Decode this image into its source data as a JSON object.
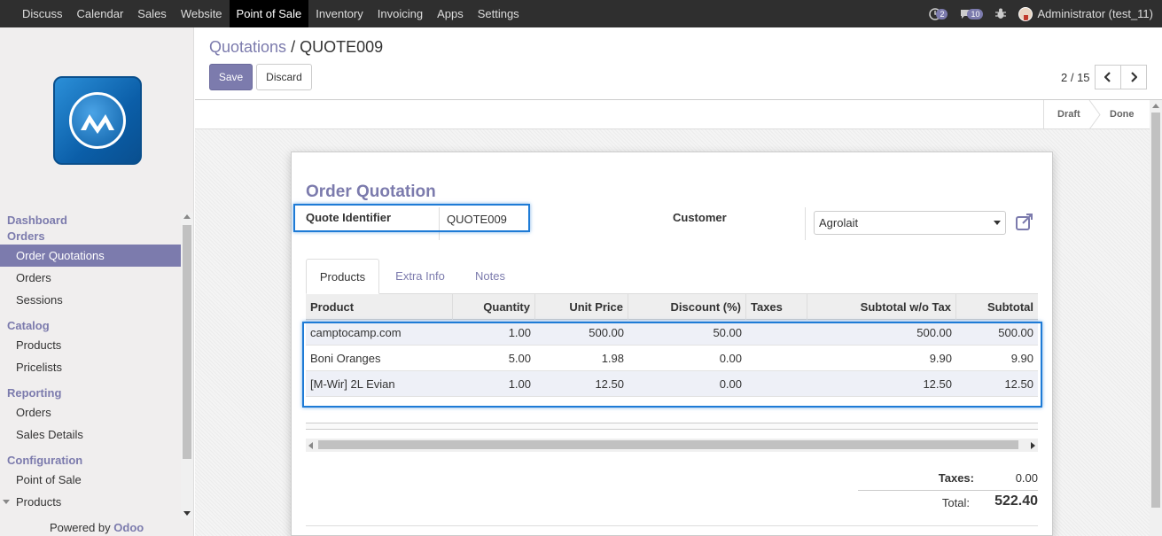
{
  "topbar": {
    "menu": [
      "Discuss",
      "Calendar",
      "Sales",
      "Website",
      "Point of Sale",
      "Inventory",
      "Invoicing",
      "Apps",
      "Settings"
    ],
    "active": "Point of Sale",
    "activity_count": "2",
    "message_count": "10",
    "user": "Administrator (test_11)"
  },
  "sidebar": {
    "sections": [
      {
        "title": "Dashboard",
        "items": []
      },
      {
        "title": "Orders",
        "items": [
          "Order Quotations",
          "Orders",
          "Sessions"
        ]
      },
      {
        "title": "Catalog",
        "items": [
          "Products",
          "Pricelists"
        ]
      },
      {
        "title": "Reporting",
        "items": [
          "Orders",
          "Sales Details"
        ]
      },
      {
        "title": "Configuration",
        "items": [
          "Point of Sale",
          "Products"
        ]
      }
    ],
    "active_item": "Order Quotations",
    "powered_by": "Powered by",
    "powered_brand": "Odoo"
  },
  "control_panel": {
    "breadcrumb_parent": "Quotations",
    "breadcrumb_sep": "/",
    "breadcrumb_current": "QUOTE009",
    "save_label": "Save",
    "discard_label": "Discard",
    "pager": "2 / 15"
  },
  "statusbar": {
    "stages": [
      "Draft",
      "Done"
    ]
  },
  "form": {
    "title": "Order Quotation",
    "quote_identifier_label": "Quote Identifier",
    "quote_identifier_value": "QUOTE009",
    "customer_label": "Customer",
    "customer_value": "Agrolait",
    "tabs": [
      "Products",
      "Extra Info",
      "Notes"
    ],
    "active_tab": "Products"
  },
  "lines": {
    "headers": [
      "Product",
      "Quantity",
      "Unit Price",
      "Discount (%)",
      "Taxes",
      "Subtotal w/o Tax",
      "Subtotal"
    ],
    "rows": [
      [
        "camptocamp.com",
        "1.00",
        "500.00",
        "50.00",
        "",
        "500.00",
        "500.00"
      ],
      [
        "Boni Oranges",
        "5.00",
        "1.98",
        "0.00",
        "",
        "9.90",
        "9.90"
      ],
      [
        "[M-Wir] 2L Evian",
        "1.00",
        "12.50",
        "0.00",
        "",
        "12.50",
        "12.50"
      ]
    ]
  },
  "totals": {
    "taxes_label": "Taxes:",
    "taxes_value": "0.00",
    "total_label": "Total:",
    "total_value": "522.40"
  },
  "colors": {
    "accent": "#7c7bad",
    "topbar": "#2f2f2f",
    "highlight": "#1e7bd6"
  }
}
